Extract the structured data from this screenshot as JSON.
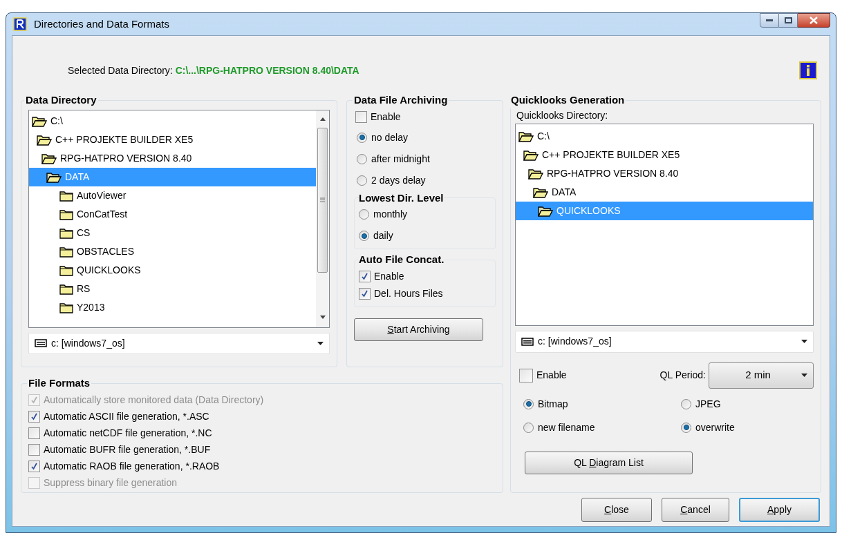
{
  "window": {
    "title": "Directories and Data Formats"
  },
  "selected_directory": {
    "label": "Selected Data Directory:",
    "value": "C:\\...\\RPG-HATPRO VERSION 8.40\\DATA"
  },
  "data_directory": {
    "title": "Data Directory",
    "drive": "c: [windows7_os]",
    "tree": [
      {
        "label": "C:\\",
        "expanded": true,
        "selected": false,
        "children": [
          {
            "label": "C++ PROJEKTE BUILDER XE5",
            "expanded": true,
            "selected": false,
            "children": [
              {
                "label": "RPG-HATPRO VERSION 8.40",
                "expanded": true,
                "selected": false,
                "children": [
                  {
                    "label": "DATA",
                    "expanded": true,
                    "selected": true,
                    "children": [
                      {
                        "label": "AutoViewer",
                        "expanded": false,
                        "selected": false
                      },
                      {
                        "label": "ConCatTest",
                        "expanded": false,
                        "selected": false
                      },
                      {
                        "label": "CS",
                        "expanded": false,
                        "selected": false
                      },
                      {
                        "label": "OBSTACLES",
                        "expanded": false,
                        "selected": false
                      },
                      {
                        "label": "QUICKLOOKS",
                        "expanded": false,
                        "selected": false
                      },
                      {
                        "label": "RS",
                        "expanded": false,
                        "selected": false
                      },
                      {
                        "label": "Y2013",
                        "expanded": false,
                        "selected": false
                      }
                    ]
                  }
                ]
              }
            ]
          }
        ]
      }
    ]
  },
  "archiving": {
    "title": "Data File Archiving",
    "enable": {
      "label": "Enable",
      "checked": false
    },
    "delay_options": [
      {
        "label": "no delay",
        "selected": true
      },
      {
        "label": "after midnight",
        "selected": false
      },
      {
        "label": "2 days delay",
        "selected": false
      }
    ],
    "lowest_level": {
      "title": "Lowest Dir. Level",
      "options": [
        {
          "label": "monthly",
          "selected": false
        },
        {
          "label": "daily",
          "selected": true
        }
      ]
    },
    "auto_concat": {
      "title": "Auto File Concat.",
      "options": [
        {
          "label": "Enable",
          "checked": true
        },
        {
          "label": "Del. Hours Files",
          "checked": true
        }
      ]
    },
    "button": {
      "key": "S",
      "rest": "tart Archiving"
    }
  },
  "file_formats": {
    "title": "File Formats",
    "items": [
      {
        "label": "Automatically store monitored data (Data Directory)",
        "checked": true,
        "disabled": true
      },
      {
        "label": "Automatic ASCII file generation, *.ASC",
        "checked": true,
        "disabled": false
      },
      {
        "label": "Automatic netCDF file generation, *.NC",
        "checked": false,
        "disabled": false
      },
      {
        "label": "Automatic BUFR file generation, *.BUF",
        "checked": false,
        "disabled": false
      },
      {
        "label": "Automatic RAOB file generation, *.RAOB",
        "checked": true,
        "disabled": false
      },
      {
        "label": "Suppress binary file generation",
        "checked": false,
        "disabled": true
      }
    ]
  },
  "quicklooks": {
    "title": "Quicklooks Generation",
    "directory_label": "Quicklooks Directory:",
    "drive": "c: [windows7_os]",
    "tree": [
      {
        "label": "C:\\",
        "expanded": true,
        "selected": false,
        "children": [
          {
            "label": "C++ PROJEKTE BUILDER XE5",
            "expanded": true,
            "selected": false,
            "children": [
              {
                "label": "RPG-HATPRO VERSION 8.40",
                "expanded": true,
                "selected": false,
                "children": [
                  {
                    "label": "DATA",
                    "expanded": true,
                    "selected": false,
                    "children": [
                      {
                        "label": "QUICKLOOKS",
                        "expanded": true,
                        "selected": true
                      }
                    ]
                  }
                ]
              }
            ]
          }
        ]
      }
    ],
    "enable": {
      "label": "Enable",
      "checked": false
    },
    "period": {
      "label": "QL Period:",
      "value": "2 min"
    },
    "format_options": [
      {
        "label": "Bitmap",
        "selected": true
      },
      {
        "label": "JPEG",
        "selected": false
      }
    ],
    "naming_options": [
      {
        "label": "new filename",
        "selected": false
      },
      {
        "label": "overwrite",
        "selected": true
      }
    ],
    "button": {
      "before": "QL ",
      "key": "D",
      "rest": "iagram List"
    }
  },
  "buttons": [
    {
      "key": "C",
      "rest": "lose",
      "default": false
    },
    {
      "key": "C",
      "rest": "ancel",
      "default": false
    },
    {
      "key": "A",
      "rest": "pply",
      "default": true
    }
  ]
}
